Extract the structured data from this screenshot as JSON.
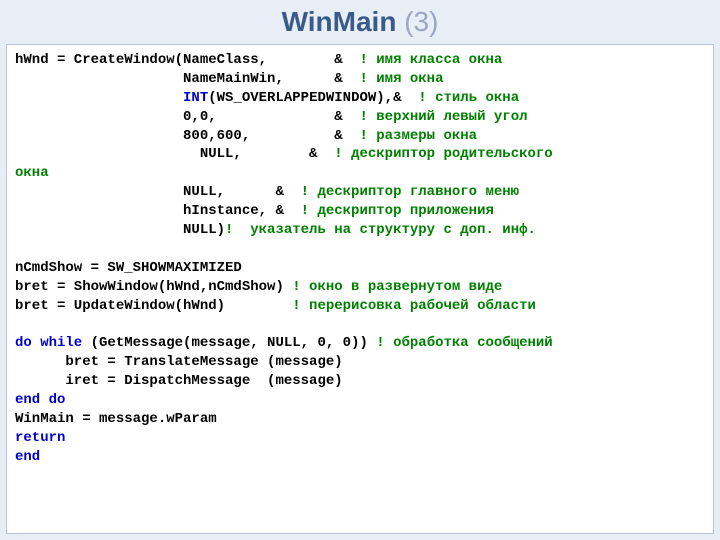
{
  "title": {
    "main": "WinMain",
    "sub": "  (3)"
  },
  "code": {
    "l1a": "hWnd = CreateWindow(NameClass,        & ",
    "l1b": " ! имя класса окна",
    "l2a": "                    NameMainWin,      & ",
    "l2b": " ! имя окна",
    "l3a": "                    ",
    "l3b": "INT",
    "l3c": "(WS_OVERLAPPEDWINDOW),& ",
    "l3d": " ! стиль окна",
    "l4a": "                    0,0,              & ",
    "l4b": " ! верхний левый угол",
    "l5a": "                    800,600,          & ",
    "l5b": " ! размеры окна",
    "l6a": "                      NULL,        & ",
    "l6b": " ! дескриптор родительского",
    "l6c": "окна",
    "l7a": "                    NULL,      & ",
    "l7b": " ! дескриптор главного меню",
    "l8a": "                    hInstance, & ",
    "l8b": " ! дескриптор приложения",
    "l9a": "                    NULL)",
    "l9b": "!  указатель на структуру с доп. инф.",
    "l10": "",
    "l11": "nCmdShow = SW_SHOWMAXIMIZED",
    "l12a": "bret = ShowWindow(hWnd,nCmdShow) ",
    "l12b": "! окно в развернутом виде",
    "l13a": "bret = UpdateWindow(hWnd)        ",
    "l13b": "! перерисовка рабочей области",
    "l14": "",
    "l15a": "do while ",
    "l15b": "(GetMessage(message, NULL, 0, 0)) ",
    "l15c": "! обработка сообщений",
    "l16": "      bret = TranslateMessage (message)",
    "l17": "      iret = DispatchMessage  (message)",
    "l18": "end do",
    "l19": "WinMain = message.wParam",
    "l20": "return",
    "l21": "end"
  }
}
